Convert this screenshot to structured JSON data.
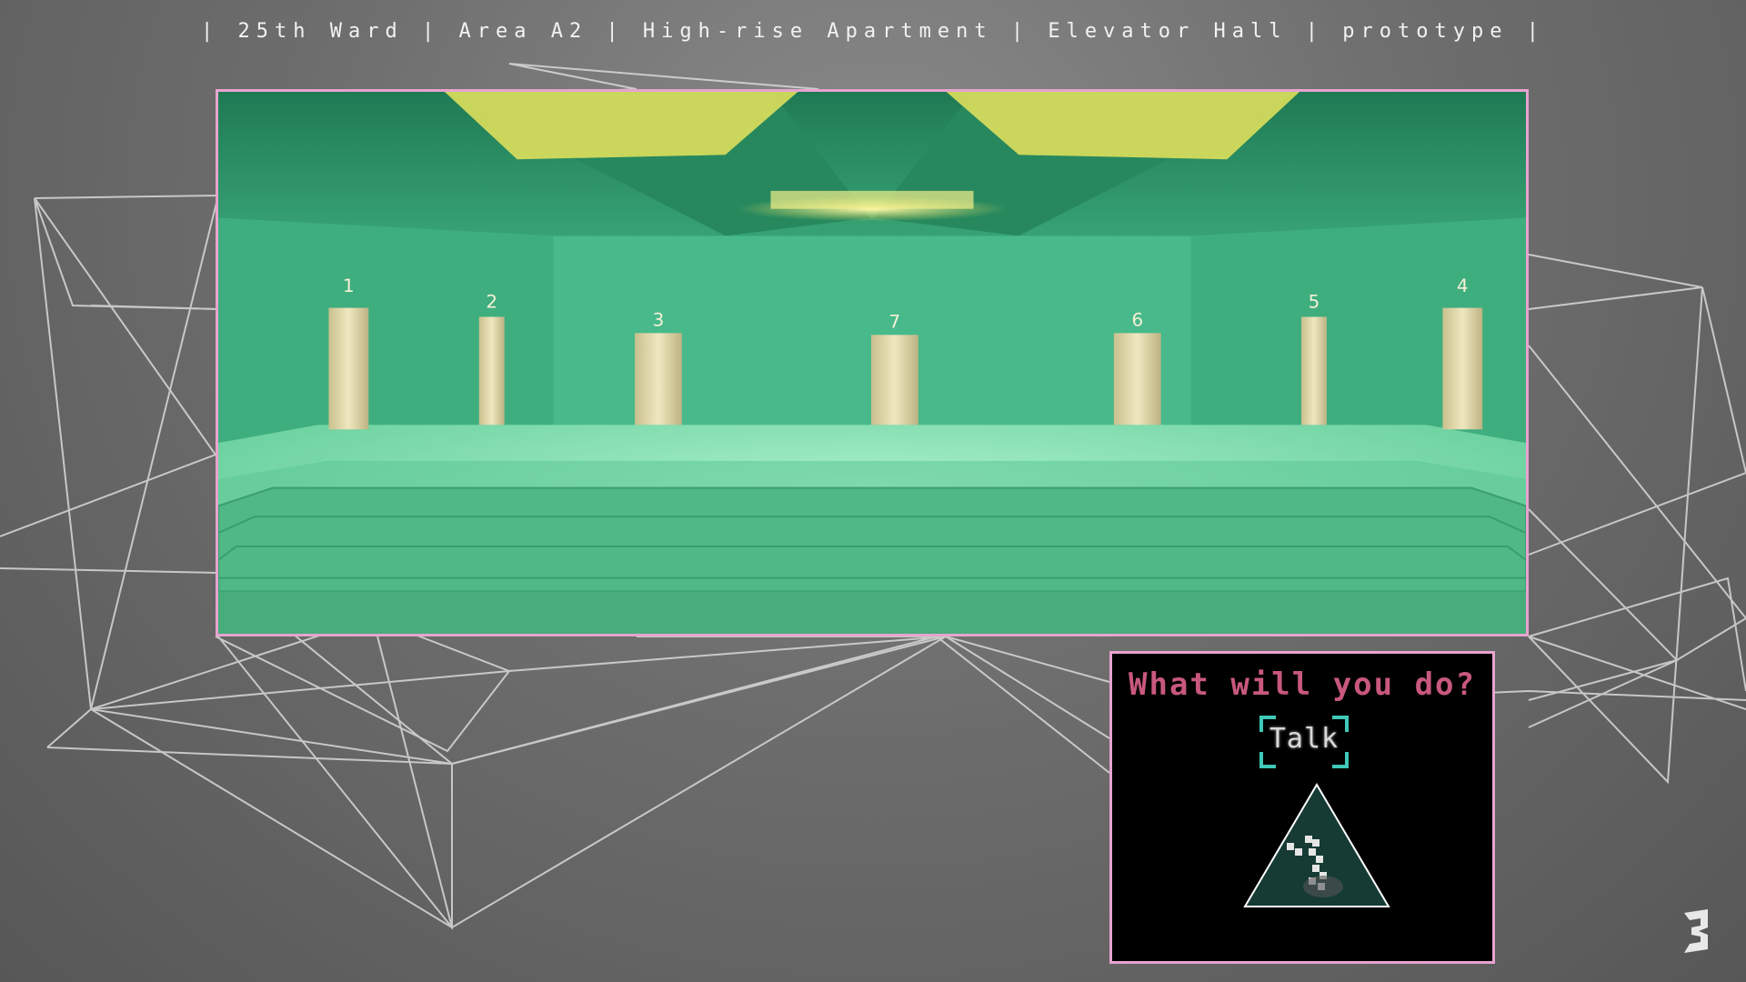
{
  "header": {
    "location": "| 25th Ward | Area A2 | High-rise Apartment | Elevator Hall | prototype |"
  },
  "scene": {
    "elevator_numbers": [
      "1",
      "2",
      "3",
      "7",
      "6",
      "5",
      "4"
    ]
  },
  "menu": {
    "title": "What will you do?",
    "options": [
      {
        "label": "Talk",
        "selected": true
      }
    ]
  },
  "colors": {
    "frame_border": "#e8a3cf",
    "menu_title": "#c8587f",
    "selection_bracket": "#3fc9b8",
    "scene_green": "#3fae7e"
  },
  "icons": {
    "selector": "triangle-character-icon",
    "logo": "studio-logo-icon"
  }
}
